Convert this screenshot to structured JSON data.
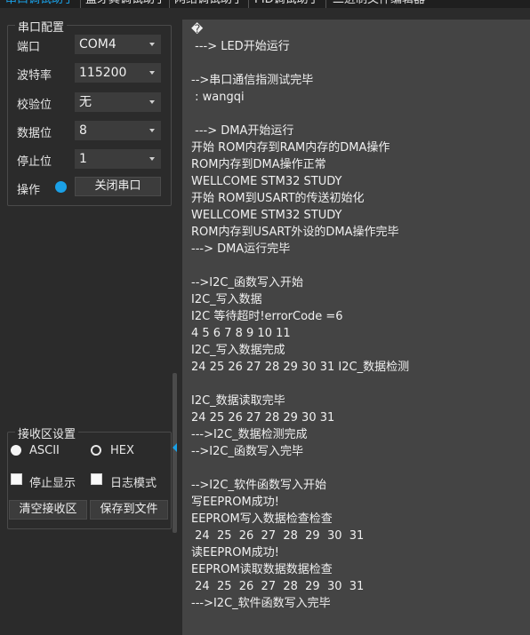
{
  "tabs": [
    {
      "label": "串口调试助手",
      "active": true
    },
    {
      "label": "蓝牙其调试助手",
      "active": false
    },
    {
      "label": "网络调试助手",
      "active": false
    },
    {
      "label": "PID调试助手",
      "active": false
    },
    {
      "label": "二进制文件编辑器",
      "active": false
    }
  ],
  "serial_config": {
    "title": "串口配置",
    "port_label": "端口",
    "port_value": "COM4",
    "baud_label": "波特率",
    "baud_value": "115200",
    "parity_label": "校验位",
    "parity_value": "无",
    "databits_label": "数据位",
    "databits_value": "8",
    "stopbits_label": "停止位",
    "stopbits_value": "1",
    "operation_label": "操作",
    "close_button": "关闭串口"
  },
  "recv_settings": {
    "title": "接收区设置",
    "ascii_label": "ASCII",
    "hex_label": "HEX",
    "ascii_checked": true,
    "hex_checked": false,
    "stop_display_label": "停止显示",
    "log_mode_label": "日志模式",
    "clear_button": "清空接收区",
    "save_button": "保存到文件"
  },
  "colors": {
    "accent": "#1aa0e6",
    "background": "#2b2b2b",
    "receive_bg": "#444444"
  },
  "receive_lines": [
    "�",
    " ---> LED开始运行",
    "",
    "-->串口通信指测试完毕",
    " : wangqi",
    "",
    " ---> DMA开始运行",
    "开始 ROM内存到RAM内存的DMA操作",
    "ROM内存到DMA操作正常",
    "WELLCOME STM32 STUDY",
    "开始 ROM到USART的传送初始化",
    "WELLCOME STM32 STUDY",
    "ROM内存到USART外设的DMA操作完毕",
    "---> DMA运行完毕",
    "",
    "-->I2C_函数写入开始",
    "I2C_写入数据",
    "I2C 等待超时!errorCode =6",
    "4 5 6 7 8 9 10 11",
    "I2C_写入数据完成",
    "24 25 26 27 28 29 30 31 I2C_数据检测",
    "",
    "I2C_数据读取完毕",
    "24 25 26 27 28 29 30 31",
    "--->I2C_数据检测完成",
    "-->I2C_函数写入完毕",
    "",
    "-->I2C_软件函数写入开始",
    "写EEPROM成功!",
    "EEPROM写入数据检查检查",
    " 24  25  26  27  28  29  30  31",
    "读EEPROM成功!",
    "EEPROM读取数据数据检查",
    " 24  25  26  27  28  29  30  31",
    "--->I2C_软件函数写入完毕"
  ]
}
